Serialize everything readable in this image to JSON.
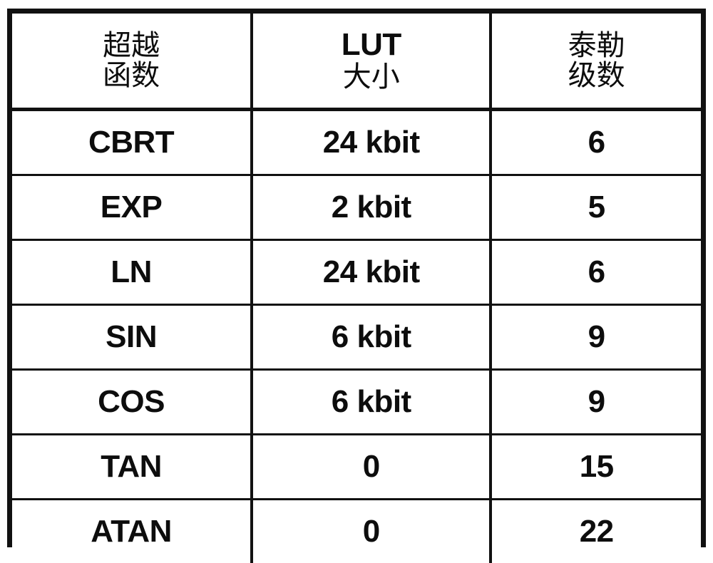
{
  "document": {
    "type": "patent-figure-table",
    "background_color": "#ffffff",
    "text_color": "#0d0d0d",
    "border_color": "#111111"
  },
  "table": {
    "headers": [
      {
        "line1": "超越",
        "line2": "函数",
        "script": "cjk"
      },
      {
        "line1": "LUT",
        "line2": "大小",
        "script": "mixed"
      },
      {
        "line1": "泰勒",
        "line2": "级数",
        "script": "cjk"
      }
    ],
    "rows": [
      {
        "function": "CBRT",
        "lut_size": "24 kbit",
        "taylor_series": "6"
      },
      {
        "function": "EXP",
        "lut_size": "2 kbit",
        "taylor_series": "5"
      },
      {
        "function": "LN",
        "lut_size": "24 kbit",
        "taylor_series": "6"
      },
      {
        "function": "SIN",
        "lut_size": "6 kbit",
        "taylor_series": "9"
      },
      {
        "function": "COS",
        "lut_size": "6 kbit",
        "taylor_series": "9"
      },
      {
        "function": "TAN",
        "lut_size": "0",
        "taylor_series": "15"
      },
      {
        "function": "ATAN",
        "lut_size": "0",
        "taylor_series": "22"
      }
    ]
  }
}
